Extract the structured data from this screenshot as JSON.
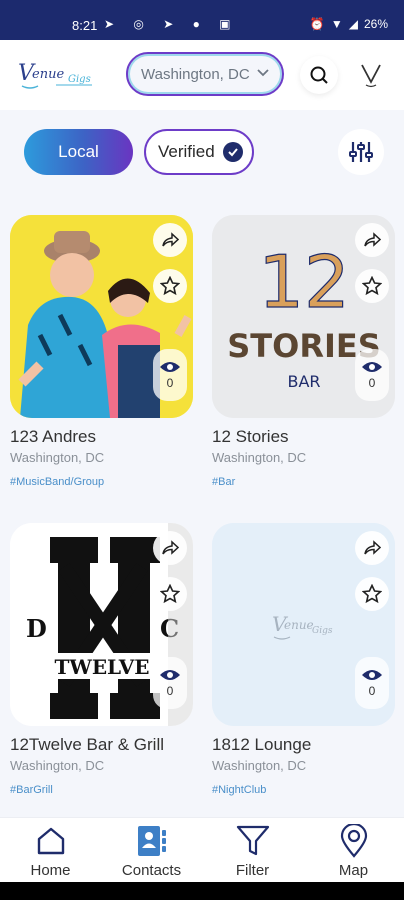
{
  "status": {
    "time": "8:21",
    "battery": "26%"
  },
  "header": {
    "logo_text": "Venue",
    "logo_suffix": "Gigs",
    "location": "Washington, DC",
    "profile_letter": "V"
  },
  "filters": {
    "local_label": "Local",
    "verified_label": "Verified"
  },
  "cards": [
    {
      "name": "123 Andres",
      "city": "Washington, DC",
      "tag": "#MusicBand/Group",
      "views": "0"
    },
    {
      "name": "12 Stories",
      "city": "Washington, DC",
      "tag": "#Bar",
      "views": "0",
      "image_big": "12",
      "image_word": "STORIES",
      "image_small": "BAR"
    },
    {
      "name": "12Twelve Bar & Grill",
      "city": "Washington, DC",
      "tag": "#BarGrill",
      "views": "0",
      "image_left": "D",
      "image_right": "C",
      "image_word": "TWELVE"
    },
    {
      "name": "1812 Lounge",
      "city": "Washington, DC",
      "tag": "#NightClub",
      "views": "0"
    }
  ],
  "nav": [
    {
      "label": "Home",
      "icon": "home-icon"
    },
    {
      "label": "Contacts",
      "icon": "contacts-icon"
    },
    {
      "label": "Filter",
      "icon": "filter-icon"
    },
    {
      "label": "Map",
      "icon": "map-pin-icon"
    }
  ],
  "colors": {
    "brand_navy": "#1c2a6e",
    "accent_purple": "#6d3cc8",
    "accent_blue": "#2d9bdc",
    "tag_blue": "#4a8fc9"
  }
}
